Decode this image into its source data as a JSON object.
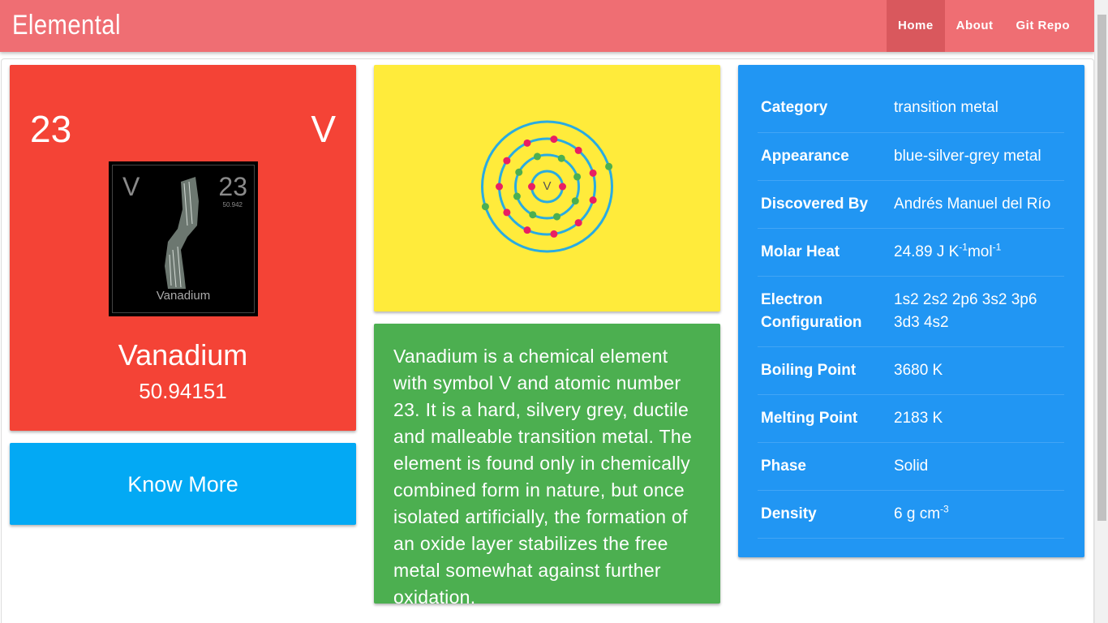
{
  "navbar": {
    "brand": "Elemental",
    "links": [
      {
        "label": "Home",
        "active": true
      },
      {
        "label": "About",
        "active": false
      },
      {
        "label": "Git Repo",
        "active": false
      }
    ],
    "color": "#ef6e73"
  },
  "element": {
    "number": "23",
    "symbol": "V",
    "name": "Vanadium",
    "mass": "50.94151",
    "image": {
      "symbol": "V",
      "number": "23",
      "mass": "50.942",
      "name": "Vanadium"
    },
    "card_color": "#f44336"
  },
  "know_more": {
    "label": "Know More",
    "color": "#03a9f4"
  },
  "bohr_model": {
    "symbol": "V",
    "shells": [
      2,
      8,
      11,
      2
    ],
    "background": "#ffeb3b"
  },
  "description": {
    "text": "Vanadium is a chemical element with symbol V and atomic number 23. It is a hard, silvery grey, ductile and malleable transition metal. The element is found only in chemically combined form in nature, but once isolated artificially, the formation of an oxide layer stabilizes the free metal somewhat against further oxidation.",
    "color": "#4caf50"
  },
  "properties": {
    "color": "#2196f3",
    "category": {
      "label": "Category",
      "value": "transition metal"
    },
    "appearance": {
      "label": "Appearance",
      "value": "blue-silver-grey metal"
    },
    "discovered_by": {
      "label": "Discovered By",
      "value": "Andrés Manuel del Río"
    },
    "molar_heat": {
      "label": "Molar Heat",
      "value": "24.89 J K",
      "sup1": "-1",
      "unit2": "mol",
      "sup2": "-1"
    },
    "electron_configuration": {
      "label": "Electron Configuration",
      "value": "1s2 2s2 2p6 3s2 3p6 3d3 4s2"
    },
    "boiling_point": {
      "label": "Boiling Point",
      "value": "3680 K"
    },
    "melting_point": {
      "label": "Melting Point",
      "value": "2183 K"
    },
    "phase": {
      "label": "Phase",
      "value": "Solid"
    },
    "density": {
      "label": "Density",
      "value": "6 g cm",
      "sup": "-3"
    }
  }
}
